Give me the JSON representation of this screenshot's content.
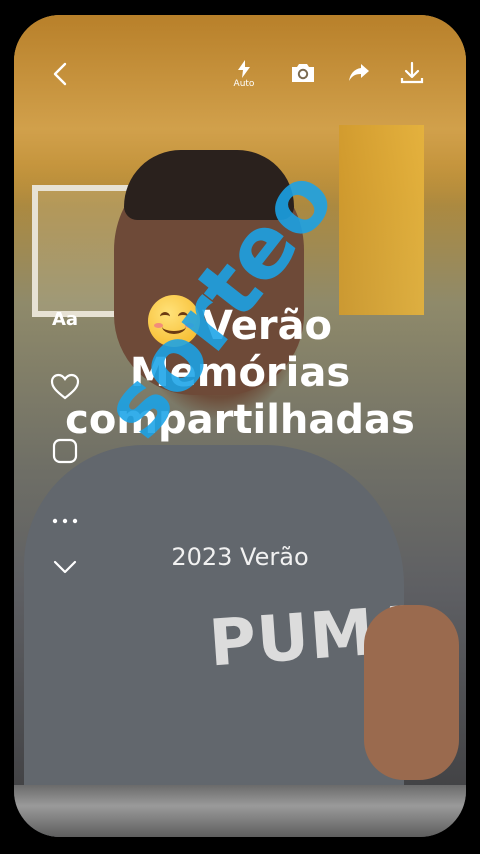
{
  "toolbar": {
    "flash_mode": "Auto",
    "icons": [
      "back-arrow-icon",
      "flash-icon",
      "camera-icon",
      "share-icon",
      "download-icon"
    ]
  },
  "side_rail": {
    "text_tool_label": "Aa",
    "icons": [
      "text-icon",
      "heart-icon",
      "sticker-icon",
      "more-icon",
      "chevron-down-icon"
    ]
  },
  "overlay": {
    "emoji": "smiling-face-icon",
    "line1": "Verão",
    "line2": "Memórias",
    "line3": "compartilhadas",
    "subtitle": "2023 Verão"
  },
  "watermark": "sorteo",
  "photo": {
    "shirt_brand": "PUMA"
  },
  "colors": {
    "watermark": "#1aa3e8",
    "background": "#000000"
  }
}
